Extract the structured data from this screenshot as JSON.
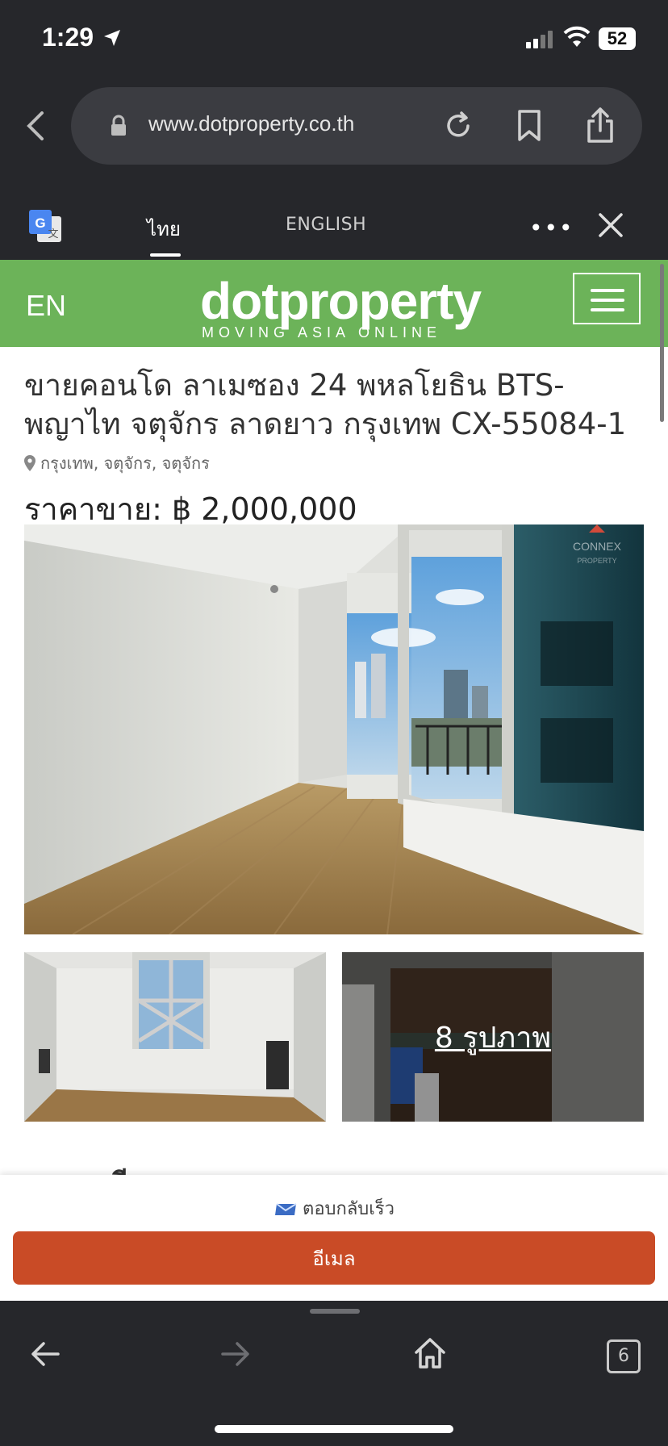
{
  "status_bar": {
    "time": "1:29",
    "battery": "52"
  },
  "browser": {
    "url": "www.dotproperty.co.th",
    "open_tabs": "6"
  },
  "translate_bar": {
    "tab_thai": "ไทย",
    "tab_english": "ENGLISH",
    "more": "•••"
  },
  "site": {
    "lang": "EN",
    "logo": "dotproperty",
    "tagline": "MOVING ASIA ONLINE"
  },
  "listing": {
    "title": "ขายคอนโด ลาเมซอง 24 พหลโยธิน BTS-พญาไท จตุจักร ลาดยาว กรุงเทพ CX-55084-1",
    "location": "กรุงเทพ, จตุจักร, จตุจักร",
    "price_label": "ราคาขาย:",
    "price_value": "฿ 2,000,000",
    "photo_count": "8 รูปภาพ",
    "details_heading": "รายละเอียด",
    "watermark": "CONNEX PROPERTY"
  },
  "contact": {
    "quick_reply": "ตอบกลับเร็ว",
    "email_button": "อีเมล"
  },
  "colors": {
    "header_green": "#6cb359",
    "email_button": "#c94b26",
    "chrome_dark": "#26272b"
  }
}
